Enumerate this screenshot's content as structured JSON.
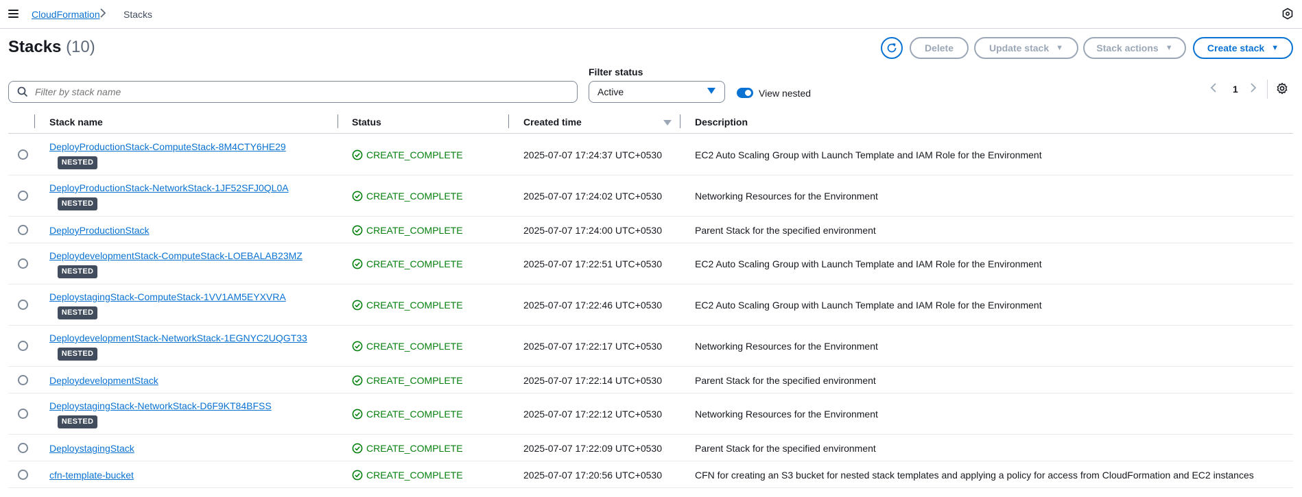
{
  "breadcrumb": {
    "service": "CloudFormation",
    "current": "Stacks"
  },
  "header": {
    "title": "Stacks",
    "count": "(10)"
  },
  "actions": {
    "delete": "Delete",
    "update": "Update stack",
    "stack_actions": "Stack actions",
    "create": "Create stack"
  },
  "filters": {
    "search_placeholder": "Filter by stack name",
    "status_label": "Filter status",
    "status_value": "Active",
    "view_nested_label": "View nested",
    "view_nested_on": true
  },
  "pagination": {
    "page": "1"
  },
  "table": {
    "columns": [
      "Stack name",
      "Status",
      "Created time",
      "Description"
    ],
    "nested_badge": "NESTED",
    "rows": [
      {
        "name": "DeployProductionStack-ComputeStack-8M4CTY6HE29",
        "nested": true,
        "status": "CREATE_COMPLETE",
        "created": "2025-07-07 17:24:37 UTC+0530",
        "description": "EC2 Auto Scaling Group with Launch Template and IAM Role for the Environment"
      },
      {
        "name": "DeployProductionStack-NetworkStack-1JF52SFJ0QL0A",
        "nested": true,
        "status": "CREATE_COMPLETE",
        "created": "2025-07-07 17:24:02 UTC+0530",
        "description": "Networking Resources for the Environment"
      },
      {
        "name": "DeployProductionStack",
        "nested": false,
        "status": "CREATE_COMPLETE",
        "created": "2025-07-07 17:24:00 UTC+0530",
        "description": "Parent Stack for the specified environment"
      },
      {
        "name": "DeploydevelopmentStack-ComputeStack-LOEBALAB23MZ",
        "nested": true,
        "status": "CREATE_COMPLETE",
        "created": "2025-07-07 17:22:51 UTC+0530",
        "description": "EC2 Auto Scaling Group with Launch Template and IAM Role for the Environment"
      },
      {
        "name": "DeploystagingStack-ComputeStack-1VV1AM5EYXVRA",
        "nested": true,
        "status": "CREATE_COMPLETE",
        "created": "2025-07-07 17:22:46 UTC+0530",
        "description": "EC2 Auto Scaling Group with Launch Template and IAM Role for the Environment"
      },
      {
        "name": "DeploydevelopmentStack-NetworkStack-1EGNYC2UQGT33",
        "nested": true,
        "status": "CREATE_COMPLETE",
        "created": "2025-07-07 17:22:17 UTC+0530",
        "description": "Networking Resources for the Environment"
      },
      {
        "name": "DeploydevelopmentStack",
        "nested": false,
        "status": "CREATE_COMPLETE",
        "created": "2025-07-07 17:22:14 UTC+0530",
        "description": "Parent Stack for the specified environment"
      },
      {
        "name": "DeploystagingStack-NetworkStack-D6F9KT84BFSS",
        "nested": true,
        "status": "CREATE_COMPLETE",
        "created": "2025-07-07 17:22:12 UTC+0530",
        "description": "Networking Resources for the Environment"
      },
      {
        "name": "DeploystagingStack",
        "nested": false,
        "status": "CREATE_COMPLETE",
        "created": "2025-07-07 17:22:09 UTC+0530",
        "description": "Parent Stack for the specified environment"
      },
      {
        "name": "cfn-template-bucket",
        "nested": false,
        "status": "CREATE_COMPLETE",
        "created": "2025-07-07 17:20:56 UTC+0530",
        "description": "CFN for creating an S3 bucket for nested stack templates and applying a policy for access from CloudFormation and EC2 instances"
      }
    ]
  },
  "colors": {
    "link": "#0972d3",
    "success": "#037f0c",
    "badge": "#414d5c",
    "disabled": "#9ba7b6"
  },
  "icons": [
    "menu-icon",
    "chevron-right-icon",
    "info-hexagon-icon",
    "refresh-icon",
    "caret-down-icon",
    "search-icon",
    "chevron-left-icon",
    "settings-gear-icon",
    "sort-caret-icon",
    "status-success-icon"
  ]
}
